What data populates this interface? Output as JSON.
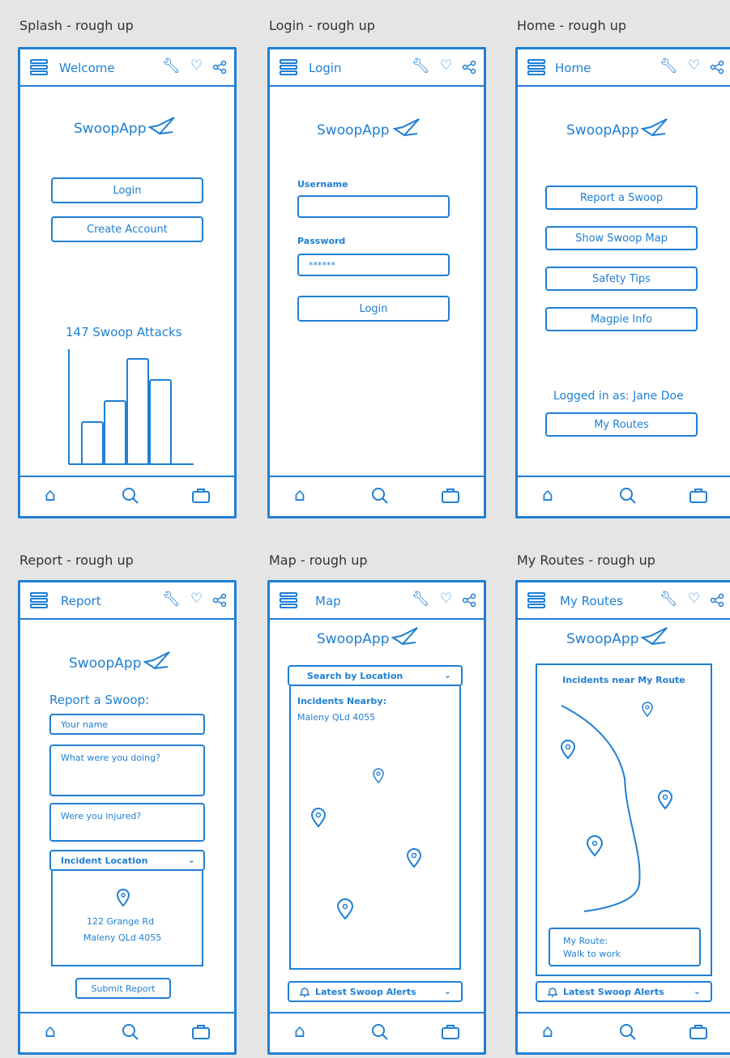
{
  "frames": [
    {
      "label": "Splash - rough up",
      "title": "Welcome"
    },
    {
      "label": "Login - rough up",
      "title": "Login"
    },
    {
      "label": "Home - rough up",
      "title": "Home"
    },
    {
      "label": "Report - rough up",
      "title": "Report"
    },
    {
      "label": "Map - rough up",
      "title": "Map"
    },
    {
      "label": "My Routes - rough up",
      "title": "My Routes"
    }
  ],
  "brand": "SwoopApp",
  "splash": {
    "login": "Login",
    "create_account": "Create Account",
    "attacks": "147 Swoop Attacks",
    "chart_values": [
      0.4,
      0.6,
      1.0,
      0.8
    ]
  },
  "login": {
    "username_label": "Username",
    "password_label": "Password",
    "password_value": "******",
    "login_button": "Login"
  },
  "home": {
    "buttons": [
      "Report a Swoop",
      "Show Swoop Map",
      "Safety Tips",
      "Magpie Info"
    ],
    "logged_in": "Logged in as: Jane Doe",
    "my_routes": "My Routes"
  },
  "report": {
    "heading": "Report a Swoop:",
    "name_ph": "Your name",
    "doing_ph": "What were you doing?",
    "injured_ph": "Were you injured?",
    "location_select": "Incident Location",
    "address_line1": "122 Grange Rd",
    "address_line2": "Maleny QLd 4055",
    "submit": "Submit Report"
  },
  "map": {
    "search": "Search by Location",
    "nearby_line1": "Incidents Nearby:",
    "nearby_line2": "Maleny QLd 4055",
    "alerts": "Latest Swoop Alerts"
  },
  "routes": {
    "heading": "Incidents near My Route",
    "route_label": "My Route:",
    "route_name": "Walk to work",
    "alerts": "Latest Swoop Alerts"
  },
  "colors": {
    "accent": "#1f7fd4",
    "background": "#e5e5e5"
  }
}
